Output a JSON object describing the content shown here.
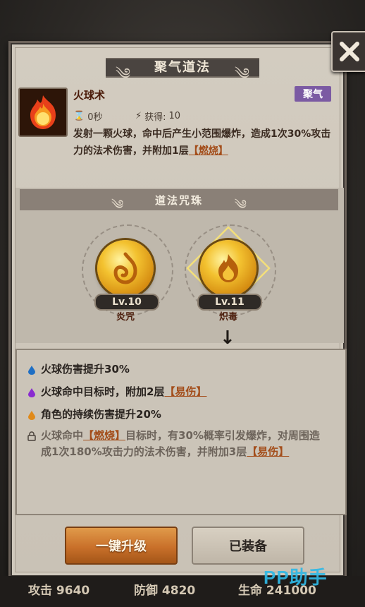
{
  "window": {
    "title": "聚气道法"
  },
  "skill": {
    "name": "火球术",
    "badge": "聚气",
    "cooldown": "0秒",
    "gain_label": "获得:",
    "gain_value": "10",
    "desc_part1": "发射一颗火球，命中后产生小范围爆炸，造成1次30%攻击力的法术伤害，并附加1层",
    "desc_tag": "【燃烧】"
  },
  "charms": {
    "header": "道法咒珠",
    "items": [
      {
        "level": "Lv.10",
        "name": "炎咒"
      },
      {
        "level": "Lv.11",
        "name": "炽毒"
      }
    ]
  },
  "effects": [
    {
      "text": "火球伤害提升30%",
      "color": "#1f6fc4"
    },
    {
      "text_a": "火球命中目标时，附加2层",
      "tag": "【易伤】",
      "color": "#8a2bd0"
    },
    {
      "text": "角色的持续伤害提升20%",
      "color": "#e08a1a"
    },
    {
      "text_a": "火球命中",
      "tag": "【燃烧】",
      "text_b": "目标时，有30%概率引发爆炸，对周围造成1次180%攻击力的法术伤害，并附加3层",
      "tag2": "【易伤】"
    }
  ],
  "buttons": {
    "upgrade": "一键升级",
    "equipped": "已装备"
  },
  "bottom_stats": {
    "attack": "攻击 9640",
    "defense": "防御 4820",
    "hp": "生命 241000"
  },
  "watermark": "PP助手",
  "colors": {
    "accent": "#c9702a",
    "badge": "#7b5aa3",
    "tag": "#a34d1a"
  }
}
